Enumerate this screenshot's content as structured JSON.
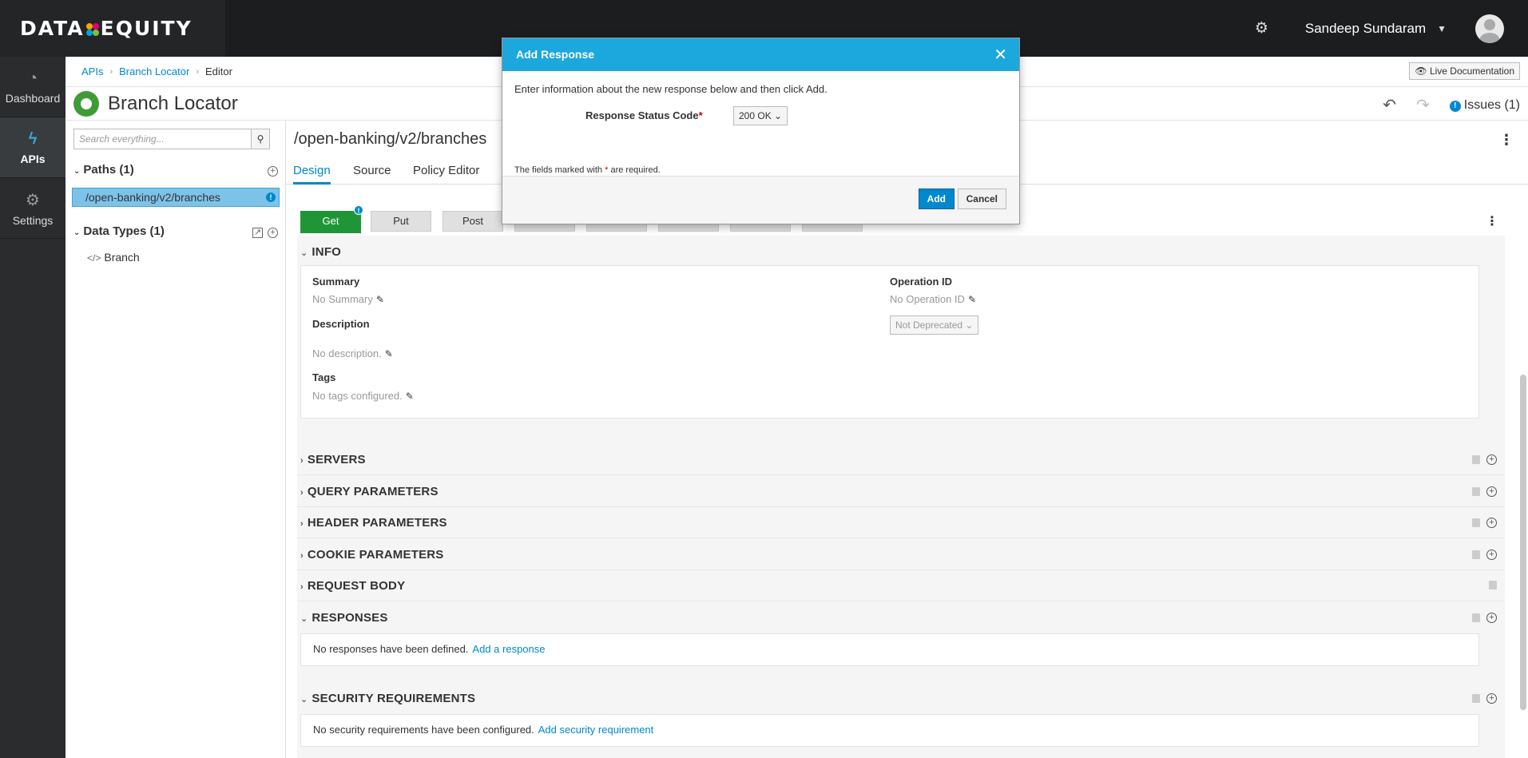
{
  "header": {
    "logo_text_left": "DATA",
    "logo_text_right": "EQUITY",
    "user_name": "Sandeep Sundaram"
  },
  "leftnav": {
    "items": [
      {
        "label": "Dashboard",
        "icon": "dashboard-icon"
      },
      {
        "label": "APIs",
        "icon": "bolt-icon"
      },
      {
        "label": "Settings",
        "icon": "gears-icon"
      }
    ]
  },
  "breadcrumb": {
    "items": [
      "APIs",
      "Branch Locator",
      "Editor"
    ],
    "live_doc": "Live Documentation"
  },
  "titlebar": {
    "title": "Branch Locator",
    "issues": "Issues (1)"
  },
  "leftpanel": {
    "search_placeholder": "Search everything...",
    "paths_header": "Paths (1)",
    "path_item": "/open-banking/v2/branches",
    "types_header": "Data Types (1)",
    "type_item": "Branch"
  },
  "main": {
    "path_title": "/open-banking/v2/branches",
    "tabs": [
      "Design",
      "Source",
      "Policy Editor"
    ],
    "operations": [
      "Get",
      "Put",
      "Post"
    ],
    "sections": {
      "info": "INFO",
      "servers": "SERVERS",
      "query": "QUERY PARAMETERS",
      "header": "HEADER PARAMETERS",
      "cookie": "COOKIE PARAMETERS",
      "body": "REQUEST BODY",
      "responses": "RESPONSES",
      "security": "SECURITY REQUIREMENTS"
    },
    "info": {
      "summary_label": "Summary",
      "summary_value": "No Summary",
      "operation_id_label": "Operation ID",
      "operation_id_value": "No Operation ID",
      "description_label": "Description",
      "description_value": "No description.",
      "deprecated": "Not Deprecated",
      "tags_label": "Tags",
      "tags_value": "No tags configured."
    },
    "responses_text": "No responses have been defined.",
    "responses_link": "Add a response",
    "security_text": "No security requirements have been configured.",
    "security_link": "Add security requirement"
  },
  "modal": {
    "title": "Add Response",
    "intro": "Enter information about the new response below and then click Add.",
    "status_label": "Response Status Code",
    "status_value": "200 OK",
    "note_before": "The fields marked with ",
    "note_after": " are required.",
    "add_label": "Add",
    "cancel_label": "Cancel"
  }
}
